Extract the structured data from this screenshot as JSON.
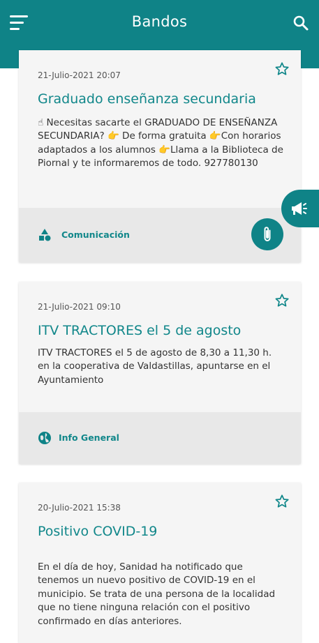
{
  "header": {
    "title": "Bandos",
    "menu_icon": "menu-icon",
    "search_icon": "search-icon",
    "color": "#0f8387"
  },
  "posts": [
    {
      "date": "21-Julio-2021 20:07",
      "title": "Graduado enseñanza secundaria",
      "body": "☝ Necesitas sacarte el GRADUADO DE ENSEÑANZA SECUNDARIA? 👉 De forma gratuita 👉Con horarios adaptados a los alumnos 👉Llama a la Biblioteca de Piornal y te informaremos de todo. 927780130",
      "category": "Comunicación",
      "category_icon": "shapes-icon",
      "has_attachment": true
    },
    {
      "date": "21-Julio-2021 09:10",
      "title": "ITV TRACTORES el 5 de agosto",
      "body": "ITV TRACTORES el 5 de agosto de 8,30 a 11,30 h. en la cooperativa de Valdastillas, apuntarse en el Ayuntamiento",
      "category": "Info General",
      "category_icon": "globe-icon",
      "has_attachment": false
    },
    {
      "date": "20-Julio-2021 15:38",
      "title": "Positivo COVID-19",
      "body": "En el día de hoy, Sanidad ha notificado que tenemos un nuevo positivo de COVID-19 en el municipio. Se trata de una persona de la localidad que no tiene ninguna relación con el positivo confirmado en días anteriores."
    }
  ],
  "fab_icon": "megaphone-icon",
  "accent_color": "#11878a"
}
